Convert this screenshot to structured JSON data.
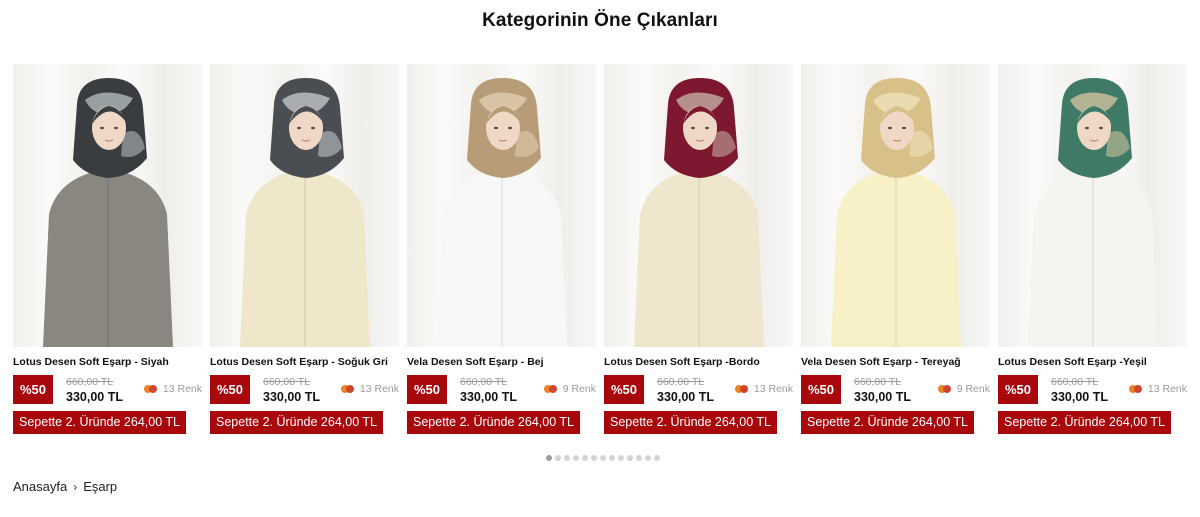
{
  "section": {
    "title": "Kategorinin Öne Çıkanları"
  },
  "products": [
    {
      "name": "Lotus Desen Soft Eşarp - Siyah",
      "discount": "%50",
      "old_price": "660,00 TL",
      "price": "330,00 TL",
      "colors": "13 Renk",
      "promo": "Sepette 2. Üründe 264,00 TL",
      "scarf": "#3a3d3f",
      "scarf2": "#b9c2c7",
      "garment": "#8a8780"
    },
    {
      "name": "Lotus Desen Soft Eşarp - Soğuk Gri",
      "discount": "%50",
      "old_price": "660,00 TL",
      "price": "330,00 TL",
      "colors": "13 Renk",
      "promo": "Sepette 2. Üründe 264,00 TL",
      "scarf": "#4a4e52",
      "scarf2": "#c9ced2",
      "garment": "#efe7c9"
    },
    {
      "name": "Vela Desen Soft Eşarp - Bej",
      "discount": "%50",
      "old_price": "660,00 TL",
      "price": "330,00 TL",
      "colors": "9 Renk",
      "promo": "Sepette 2. Üründe 264,00 TL",
      "scarf": "#b79c77",
      "scarf2": "#e3d2b3",
      "garment": "#f7f7f5"
    },
    {
      "name": "Lotus Desen Soft Eşarp -Bordo",
      "discount": "%50",
      "old_price": "660,00 TL",
      "price": "330,00 TL",
      "colors": "13 Renk",
      "promo": "Sepette 2. Üründe 264,00 TL",
      "scarf": "#7d1830",
      "scarf2": "#c8b7a8",
      "garment": "#efe7cd"
    },
    {
      "name": "Vela Desen Soft Eşarp - Tereyağ",
      "discount": "%50",
      "old_price": "660,00 TL",
      "price": "330,00 TL",
      "colors": "9 Renk",
      "promo": "Sepette 2. Üründe 264,00 TL",
      "scarf": "#d8c089",
      "scarf2": "#efe3bd",
      "garment": "#f8f1c8"
    },
    {
      "name": "Lotus Desen Soft Eşarp -Yeşil",
      "discount": "%50",
      "old_price": "660,00 TL",
      "price": "330,00 TL",
      "colors": "13 Renk",
      "promo": "Sepette 2. Üründe 264,00 TL",
      "scarf": "#3f7a66",
      "scarf2": "#d9c7a3",
      "garment": "#f6f4ef"
    }
  ],
  "pagination": {
    "total": 13,
    "active": 0
  },
  "breadcrumb": {
    "home": "Anasayfa",
    "separator": "›",
    "current": "Eşarp"
  },
  "theme": {
    "accent": "#a8070b"
  }
}
